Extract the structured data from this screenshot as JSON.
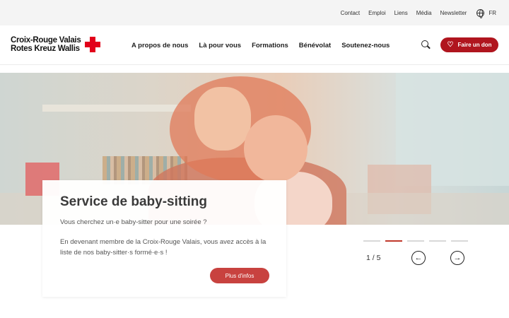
{
  "topbar": {
    "links": [
      "Contact",
      "Emploi",
      "Liens",
      "Média",
      "Newsletter"
    ],
    "language": "FR"
  },
  "logo": {
    "line1": "Croix-Rouge Valais",
    "line2": "Rotes Kreuz Wallis"
  },
  "nav": {
    "items": [
      "A propos de nous",
      "Là pour vous",
      "Formations",
      "Bénévolat",
      "Soutenez-nous"
    ]
  },
  "header": {
    "donate_label": "Faire un don"
  },
  "slide": {
    "title": "Service de baby-sitting",
    "line1": "Vous cherchez un·e baby-sitter pour une soirée ?",
    "line2": "En devenant membre de la Croix-Rouge Valais, vous avez accès à la liste de nos baby-sitter·s formé·e·s !",
    "button": "Plus d'infos"
  },
  "slider": {
    "counter": "1 / 5",
    "total_dots": 5,
    "active_dot": 2
  },
  "colors": {
    "brand_red": "#e2001a",
    "button_red": "#b0151e"
  }
}
